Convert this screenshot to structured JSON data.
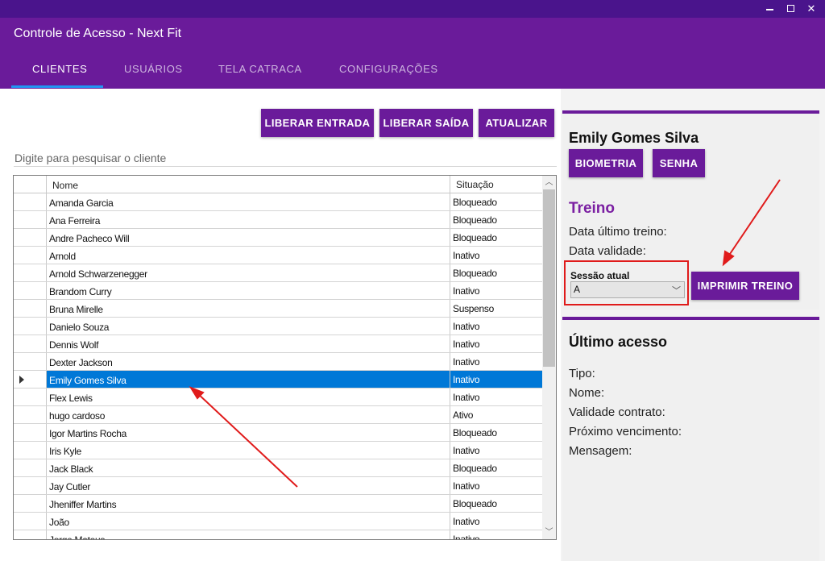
{
  "window": {
    "title": "Controle de Acesso - Next Fit",
    "controls": {
      "minimize_icon": "minimize-icon",
      "maximize_icon": "maximize-icon",
      "close_label": "✕"
    }
  },
  "tabs": [
    {
      "label": "CLIENTES",
      "active": true
    },
    {
      "label": "USUÁRIOS",
      "active": false
    },
    {
      "label": "TELA CATRACA",
      "active": false
    },
    {
      "label": "CONFIGURAÇÕES",
      "active": false
    }
  ],
  "toolbar": {
    "liberar_entrada": "LIBERAR ENTRADA",
    "liberar_saida": "LIBERAR SAÍDA",
    "atualizar": "ATUALIZAR"
  },
  "search": {
    "placeholder": "Digite para pesquisar o cliente",
    "value": ""
  },
  "grid": {
    "headers": {
      "nome": "Nome",
      "situacao": "Situação"
    },
    "rows": [
      {
        "nome": "Amanda Garcia",
        "situacao": "Bloqueado"
      },
      {
        "nome": "Ana Ferreira",
        "situacao": "Bloqueado"
      },
      {
        "nome": "Andre Pacheco Will",
        "situacao": "Bloqueado"
      },
      {
        "nome": "Arnold",
        "situacao": "Inativo"
      },
      {
        "nome": "Arnold Schwarzenegger",
        "situacao": "Bloqueado"
      },
      {
        "nome": "Brandom Curry",
        "situacao": "Inativo"
      },
      {
        "nome": "Bruna Mirelle",
        "situacao": "Suspenso"
      },
      {
        "nome": "Danielo Souza",
        "situacao": "Inativo"
      },
      {
        "nome": "Dennis Wolf",
        "situacao": "Inativo"
      },
      {
        "nome": "Dexter Jackson",
        "situacao": "Inativo"
      },
      {
        "nome": "Emily Gomes Silva",
        "situacao": "Inativo",
        "selected": true
      },
      {
        "nome": "Flex Lewis",
        "situacao": "Inativo"
      },
      {
        "nome": "hugo cardoso",
        "situacao": "Ativo"
      },
      {
        "nome": "Igor Martins Rocha",
        "situacao": "Bloqueado"
      },
      {
        "nome": "Iris Kyle",
        "situacao": "Inativo"
      },
      {
        "nome": "Jack Black",
        "situacao": "Bloqueado"
      },
      {
        "nome": "Jay Cutler",
        "situacao": "Inativo"
      },
      {
        "nome": "Jheniffer Martins",
        "situacao": "Bloqueado"
      },
      {
        "nome": "João",
        "situacao": "Inativo"
      },
      {
        "nome": "Jorge Mateus",
        "situacao": "Inativo"
      }
    ]
  },
  "client_card": {
    "name": "Emily Gomes Silva",
    "biometria": "BIOMETRIA",
    "senha": "SENHA",
    "treino_title": "Treino",
    "data_ultimo_treino": "Data último treino:",
    "data_validade": "Data validade:",
    "sessao_label": "Sessão atual",
    "sessao_value": "A",
    "imprimir": "IMPRIMIR TREINO"
  },
  "ultimo_acesso": {
    "title": "Último acesso",
    "tipo": "Tipo:",
    "nome": "Nome:",
    "validade_contrato": "Validade contrato:",
    "proximo_vencimento": "Próximo vencimento:",
    "mensagem": "Mensagem:"
  },
  "colors": {
    "primary": "#6a1b9a",
    "title_strip": "#4a148c",
    "tab_indicator": "#2196f3",
    "selection": "#0078d7",
    "annotation": "#e01b1b"
  }
}
